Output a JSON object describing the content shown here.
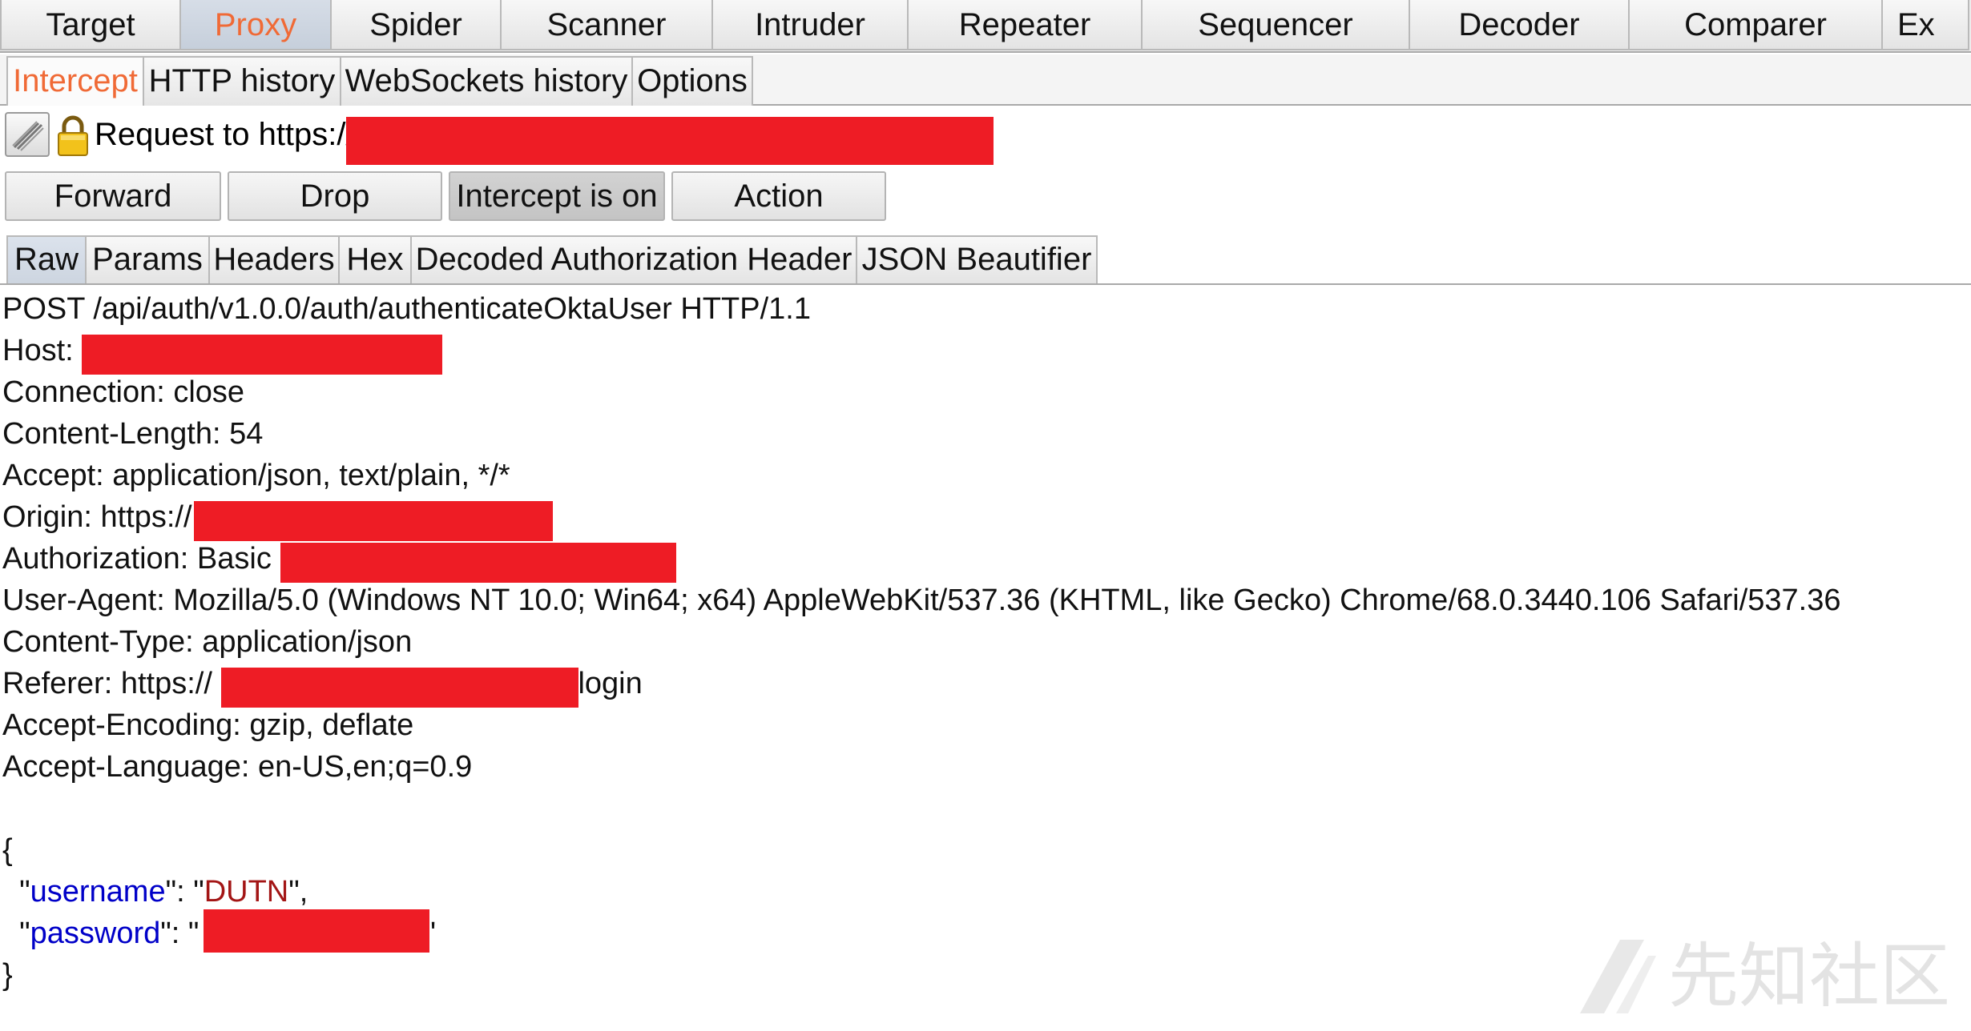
{
  "top_tabs": [
    {
      "label": "Target"
    },
    {
      "label": "Proxy",
      "active": true
    },
    {
      "label": "Spider"
    },
    {
      "label": "Scanner"
    },
    {
      "label": "Intruder"
    },
    {
      "label": "Repeater"
    },
    {
      "label": "Sequencer"
    },
    {
      "label": "Decoder"
    },
    {
      "label": "Comparer"
    },
    {
      "label": "Ex"
    }
  ],
  "sub_tabs": [
    {
      "label": "Intercept",
      "active": true
    },
    {
      "label": "HTTP history"
    },
    {
      "label": "WebSockets history"
    },
    {
      "label": "Options"
    }
  ],
  "request_bar": {
    "label": "Request to https://"
  },
  "actions": {
    "forward": "Forward",
    "drop": "Drop",
    "intercept": "Intercept is on",
    "action": "Action"
  },
  "editor_tabs": [
    {
      "label": "Raw",
      "active": true
    },
    {
      "label": "Params"
    },
    {
      "label": "Headers"
    },
    {
      "label": "Hex"
    },
    {
      "label": "Decoded Authorization Header"
    },
    {
      "label": "JSON Beautifier"
    }
  ],
  "request": {
    "request_line": "POST /api/auth/v1.0.0/auth/authenticateOktaUser HTTP/1.1",
    "host_prefix": "Host: ",
    "connection": "Connection: close",
    "content_length": "Content-Length: 54",
    "accept": "Accept: application/json, text/plain, */*",
    "origin_prefix": "Origin: https://",
    "authorization_prefix": "Authorization: Basic ",
    "user_agent": "User-Agent: Mozilla/5.0 (Windows NT 10.0; Win64; x64) AppleWebKit/537.36 (KHTML, like Gecko) Chrome/68.0.3440.106 Safari/537.36",
    "content_type": "Content-Type: application/json",
    "referer_prefix": "Referer: https://",
    "referer_suffix": "/login",
    "accept_encoding": "Accept-Encoding: gzip, deflate",
    "accept_language": "Accept-Language: en-US,en;q=0.9",
    "body_open": "{",
    "username_key": "username",
    "username_value": "DUTN",
    "password_key": "password",
    "body_close": "}"
  },
  "watermark": {
    "text": "先知社区"
  },
  "colors": {
    "active_tab_text": "#f06a36",
    "redaction": "#ee1c25",
    "json_key": "#0000c8",
    "json_string": "#a31515"
  }
}
